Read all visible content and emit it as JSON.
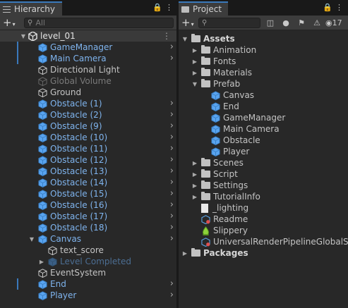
{
  "hierarchy": {
    "tab_title": "Hierarchy",
    "add_label": "+",
    "search_placeholder": "All",
    "scene_name": "level_01",
    "items": [
      {
        "label": "GameManager",
        "prefab": true,
        "selected_bar": true,
        "chevron": true
      },
      {
        "label": "Main Camera",
        "prefab": true,
        "selected_bar": true,
        "chevron": true
      },
      {
        "label": "Directional Light",
        "prefab": false
      },
      {
        "label": "Global Volume",
        "prefab": false,
        "disabled": true
      },
      {
        "label": "Ground",
        "prefab": false
      },
      {
        "label": "Obstacle (1)",
        "prefab": true,
        "chevron": true
      },
      {
        "label": "Obstacle (2)",
        "prefab": true,
        "chevron": true
      },
      {
        "label": "Obstacle (9)",
        "prefab": true,
        "chevron": true
      },
      {
        "label": "Obstacle (10)",
        "prefab": true,
        "chevron": true
      },
      {
        "label": "Obstacle (11)",
        "prefab": true,
        "chevron": true
      },
      {
        "label": "Obstacle (12)",
        "prefab": true,
        "chevron": true
      },
      {
        "label": "Obstacle (13)",
        "prefab": true,
        "chevron": true
      },
      {
        "label": "Obstacle (14)",
        "prefab": true,
        "chevron": true
      },
      {
        "label": "Obstacle (15)",
        "prefab": true,
        "chevron": true
      },
      {
        "label": "Obstacle (16)",
        "prefab": true,
        "chevron": true
      },
      {
        "label": "Obstacle (17)",
        "prefab": true,
        "chevron": true
      },
      {
        "label": "Obstacle (18)",
        "prefab": true,
        "chevron": true
      },
      {
        "label": "Canvas",
        "prefab": true,
        "chevron": true,
        "expanded": true
      },
      {
        "label": "text_score",
        "prefab": false,
        "child": true
      },
      {
        "label": "Level Completed",
        "prefab": true,
        "disabled": true,
        "child": true,
        "collapsed": true
      },
      {
        "label": "EventSystem",
        "prefab": false
      },
      {
        "label": "End",
        "prefab": true,
        "selected_bar": true,
        "chevron": true
      },
      {
        "label": "Player",
        "prefab": true,
        "chevron": true
      }
    ]
  },
  "project": {
    "tab_title": "Project",
    "add_label": "+",
    "badge_count": "17",
    "tree": [
      {
        "label": "Assets",
        "kind": "folder",
        "depth": 0,
        "expanded": true,
        "bold": true
      },
      {
        "label": "Animation",
        "kind": "folder",
        "depth": 1,
        "collapsed": true
      },
      {
        "label": "Fonts",
        "kind": "folder",
        "depth": 1,
        "collapsed": true
      },
      {
        "label": "Materials",
        "kind": "folder",
        "depth": 1,
        "collapsed": true
      },
      {
        "label": "Prefab",
        "kind": "folder",
        "depth": 1,
        "expanded": true
      },
      {
        "label": "Canvas",
        "kind": "prefab",
        "depth": 2
      },
      {
        "label": "End",
        "kind": "prefab",
        "depth": 2
      },
      {
        "label": "GameManager",
        "kind": "prefab",
        "depth": 2
      },
      {
        "label": "Main Camera",
        "kind": "prefab",
        "depth": 2
      },
      {
        "label": "Obstacle",
        "kind": "prefab",
        "depth": 2
      },
      {
        "label": "Player",
        "kind": "prefab",
        "depth": 2
      },
      {
        "label": "Scenes",
        "kind": "folder",
        "depth": 1,
        "collapsed": true
      },
      {
        "label": "Script",
        "kind": "folder",
        "depth": 1,
        "collapsed": true
      },
      {
        "label": "Settings",
        "kind": "folder",
        "depth": 1,
        "collapsed": true
      },
      {
        "label": "TutorialInfo",
        "kind": "folder",
        "depth": 1,
        "collapsed": true
      },
      {
        "label": "_lighting",
        "kind": "file",
        "depth": 1
      },
      {
        "label": "Readme",
        "kind": "asset",
        "depth": 1
      },
      {
        "label": "Slippery",
        "kind": "material",
        "depth": 1
      },
      {
        "label": "UniversalRenderPipelineGlobalSettings",
        "kind": "asset",
        "depth": 1
      },
      {
        "label": "Packages",
        "kind": "folder",
        "depth": 0,
        "collapsed": true,
        "bold": true
      }
    ]
  },
  "colors": {
    "accent": "#3a79bb",
    "prefab_text": "#7fb4ee",
    "prefab_icon": "#59a4f0",
    "panel_bg": "#282828"
  }
}
